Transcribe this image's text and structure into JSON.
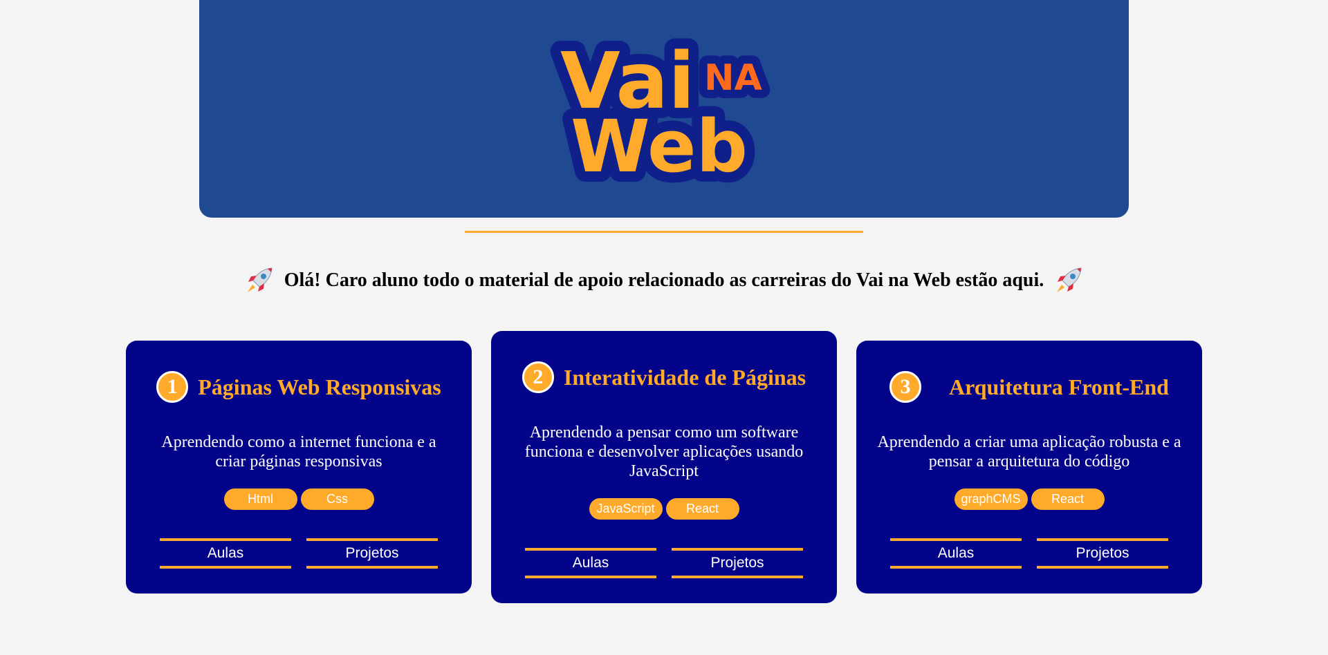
{
  "logo": {
    "line1": "Vai",
    "badge": "NA",
    "line2": "Web"
  },
  "greeting": "Olá! Caro aluno todo o material de apoio relacionado as carreiras do Vai na Web estão aqui.",
  "cards": [
    {
      "number": "1",
      "title": "Páginas Web Responsivas",
      "description": "Aprendendo como a internet funciona e a criar páginas responsivas",
      "tags": [
        "Html",
        "Css"
      ],
      "buttons": [
        "Aulas",
        "Projetos"
      ]
    },
    {
      "number": "2",
      "title": "Interatividade de Páginas",
      "description": "Aprendendo a pensar como um software funciona e desenvolver aplicações usando JavaScript",
      "tags": [
        "JavaScript",
        "React"
      ],
      "buttons": [
        "Aulas",
        "Projetos"
      ]
    },
    {
      "number": "3",
      "title": "Arquitetura Front-End",
      "description": "Aprendendo a criar uma aplicação robusta e a pensar a arquitetura do código",
      "tags": [
        "graphCMS",
        "React"
      ],
      "buttons": [
        "Aulas",
        "Projetos"
      ]
    }
  ],
  "colors": {
    "background": "#f4f4f4",
    "hero": "#1f4a91",
    "card": "#03048a",
    "accent": "#ffaa2b",
    "logo_badge": "#ff6a1f"
  },
  "icons": [
    "rocket-icon"
  ]
}
